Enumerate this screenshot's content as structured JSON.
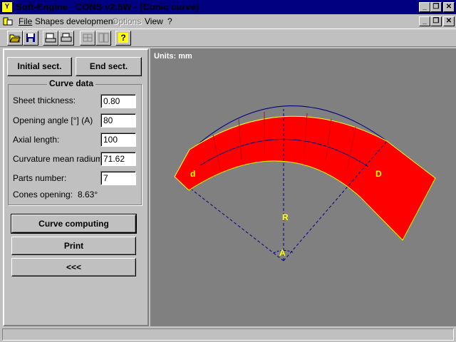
{
  "window": {
    "title": "Soft-Engine   CONS v2.5W - [Conic curve]",
    "app_icon_glyph": "Y"
  },
  "title_controls": {
    "minimize": "_",
    "restore": "❐",
    "close": "✕"
  },
  "menu": {
    "file": "File",
    "shapes": "Shapes development",
    "options": "Options",
    "view": "View",
    "help": "?"
  },
  "toolbar": {
    "open_icon": "folder-open-icon",
    "save_icon": "floppy-disk-icon",
    "print_setup_icon": "print-setup-icon",
    "print_icon": "printer-icon",
    "icon5": "resize-icon",
    "icon6": "pages-icon",
    "help_icon": "help-icon",
    "help_glyph": "?"
  },
  "panel": {
    "initial_sect": "Initial sect.",
    "end_sect": "End sect.",
    "group_title": "Curve data",
    "fields": [
      {
        "label": "Sheet thickness:",
        "value": "0.80"
      },
      {
        "label": "Opening angle [°] (A)",
        "value": "80"
      },
      {
        "label": "Axial length:",
        "value": "100"
      },
      {
        "label": "Curvature mean radium:",
        "value": "71.62"
      },
      {
        "label": "Parts number:",
        "value": "7"
      }
    ],
    "cones_opening_label": "Cones opening:",
    "cones_opening_value": "8.63°",
    "curve_computing": "Curve computing",
    "print": "Print",
    "back": "<<<"
  },
  "drawing": {
    "units": "Units: mm",
    "label_d": "d",
    "label_D": "D",
    "label_R": "R",
    "label_A": "A",
    "fill_color": "#ff0000",
    "outline_color": "#ffff00",
    "mean_line_color": "#000080"
  },
  "status": {
    "text": ""
  }
}
